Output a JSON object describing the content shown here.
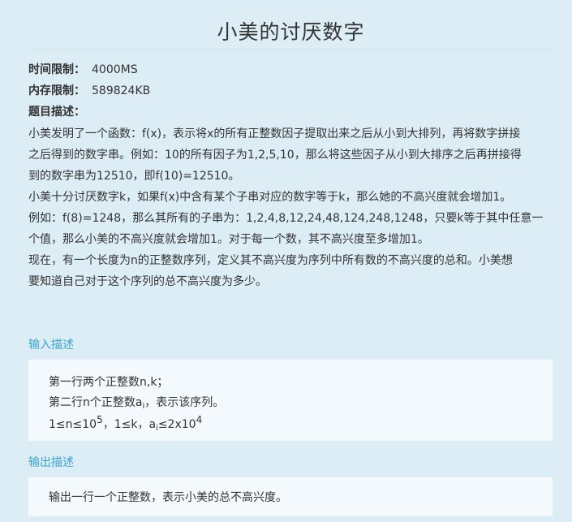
{
  "title": "小美的讨厌数字",
  "meta": {
    "time_label": "时间限制：",
    "time_value": "4000MS",
    "mem_label": "内存限制：",
    "mem_value": "589824KB",
    "desc_label": "题目描述："
  },
  "description": [
    "小美发明了一个函数：f(x)，表示将x的所有正整数因子提取出来之后从小到大排列，再将数字拼接",
    "之后得到的数字串。例如：10的所有因子为1,2,5,10，那么将这些因子从小到大排序之后再拼接得",
    "到的数字串为12510，即f(10)=12510。",
    "小美十分讨厌数字k，如果f(x)中含有某个子串对应的数字等于k，那么她的不高兴度就会增加1。",
    "例如：f(8)=1248，那么其所有的子串为：1,2,4,8,12,24,48,124,248,1248，只要k等于其中任意一",
    "个值，那么小美的不高兴度就会增加1。对于每一个数，其不高兴度至多增加1。",
    "现在，有一个长度为n的正整数序列，定义其不高兴度为序列中所有数的不高兴度的总和。小美想",
    "要知道自己对于这个序列的总不高兴度为多少。"
  ],
  "input": {
    "heading": "输入描述",
    "line1": "第一行两个正整数n,k；",
    "line2_pre": "第二行n个正整数a",
    "line2_sub": "i",
    "line2_post": "，表示该序列。",
    "line3_a": "1≤n≤10",
    "line3_sup1": "5",
    "line3_b": "，1≤k，a",
    "line3_sub": "i",
    "line3_c": "≤2x10",
    "line3_sup2": "4"
  },
  "output": {
    "heading": "输出描述",
    "line1": "输出一行一个正整数，表示小美的总不高兴度。"
  }
}
